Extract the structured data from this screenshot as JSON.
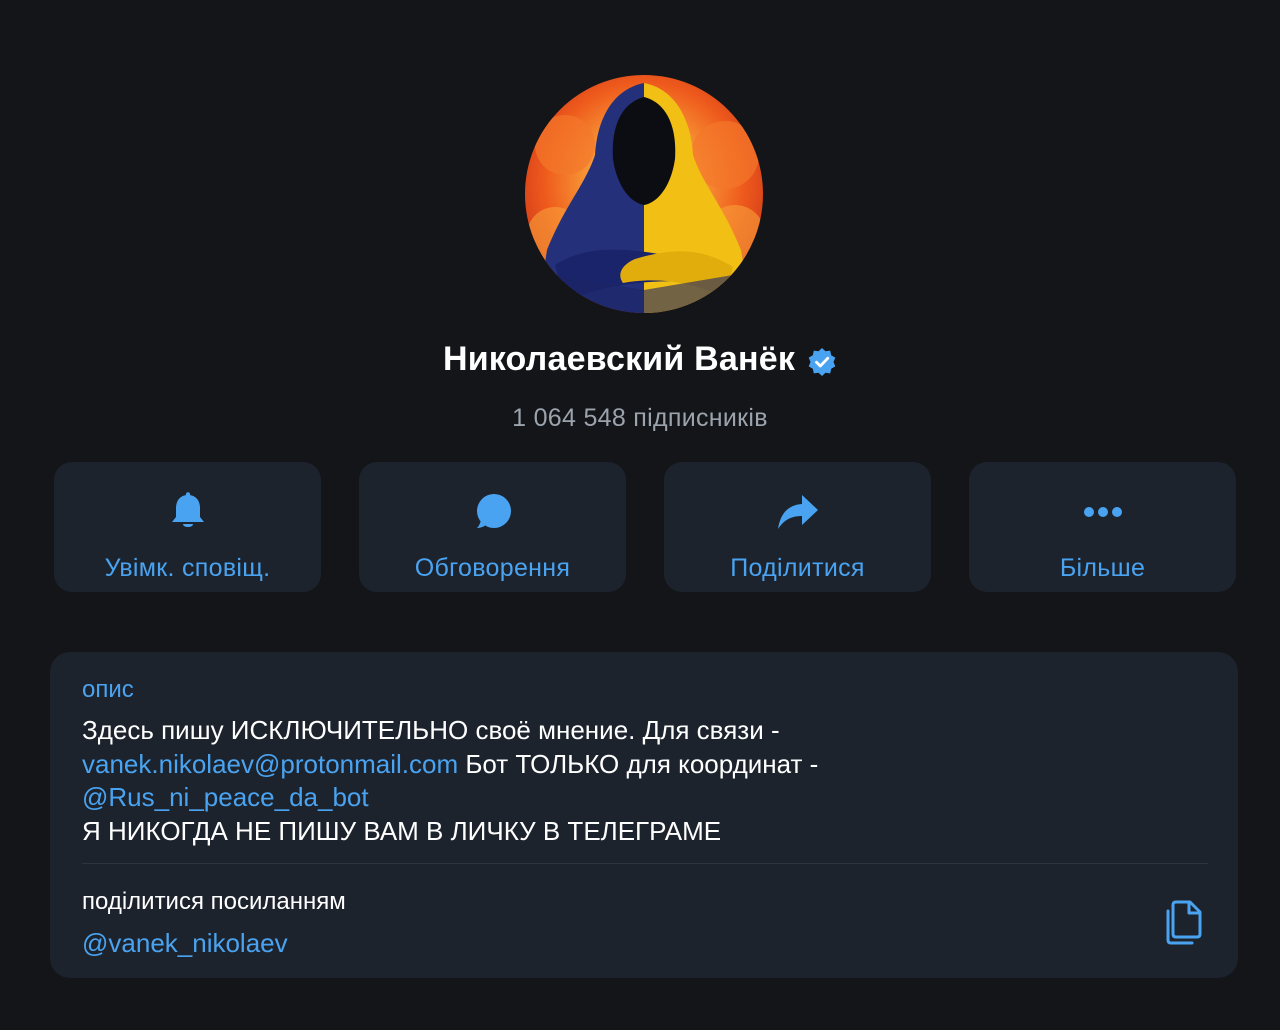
{
  "profile": {
    "name": "Николаевский Ванёк",
    "subscribers": "1 064 548 підписників",
    "avatar_icon": "hooded-figure-avatar",
    "verified_icon": "verified-badge-icon"
  },
  "actions": [
    {
      "label": "Увімк. сповіщ.",
      "icon": "bell-icon"
    },
    {
      "label": "Обговорення",
      "icon": "chat-bubble-icon"
    },
    {
      "label": "Поділитися",
      "icon": "share-arrow-icon"
    },
    {
      "label": "Більше",
      "icon": "more-dots-icon"
    }
  ],
  "info": {
    "description_title": "опис",
    "description_line1": "Здесь пишу ИСКЛЮЧИТЕЛЬНО своё мнение. Для связи -",
    "description_email": "vanek.nikolaev@protonmail.com",
    "description_line2_rest": " Бот ТОЛЬКО для координат -",
    "description_bot": "@Rus_ni_peace_da_bot",
    "description_line4": "Я НИКОГДА НЕ ПИШУ ВАМ В ЛИЧКУ В ТЕЛЕГРАМЕ",
    "share_title": "поділитися посиланням",
    "share_link": "@vanek_nikolaev",
    "copy_icon": "copy-icon"
  },
  "colors": {
    "background": "#141519",
    "card": "#1c232d",
    "accent": "#4aa3f0",
    "secondary_text": "#9ba3ad"
  }
}
